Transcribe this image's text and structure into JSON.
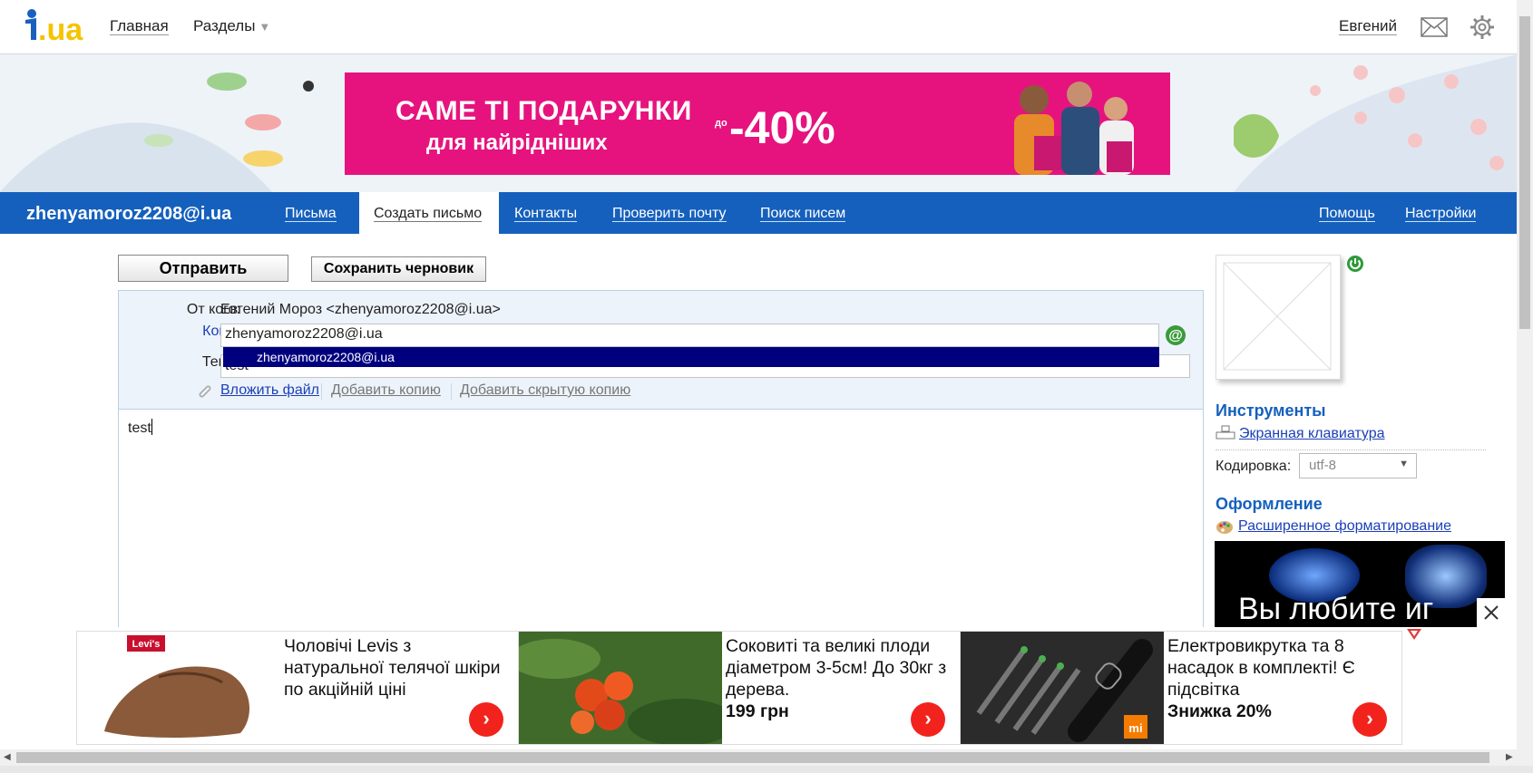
{
  "header": {
    "logo_text": "i.ua",
    "nav_home": "Главная",
    "nav_sections": "Разделы",
    "user_name": "Евгений"
  },
  "banner_ad": {
    "line1": "САМЕ ТІ ПОДАРУНКИ",
    "line2": "для найрідніших",
    "discount": "-40%",
    "prefix": "до"
  },
  "mail_nav": {
    "account": "zhenyamoroz2208@i.ua",
    "tabs": [
      "Письма",
      "Создать письмо",
      "Контакты",
      "Проверить почту",
      "Поиск писем"
    ],
    "active_tab": "Создать письмо",
    "help": "Помощь",
    "settings": "Настройки"
  },
  "toolbar": {
    "send_label": "Отправить",
    "draft_label": "Сохранить черновик"
  },
  "compose": {
    "from_label": "От кого:",
    "from_value": "Евгений Мороз <zhenyamoroz2208@i.ua>",
    "to_label": "Кому:",
    "to_value": "zhenyamoroz2208@i.ua",
    "autocomplete_item": "zhenyamoroz2208@i.ua",
    "subject_label": "Тема:",
    "subject_value": "test",
    "attach_label": "Вложить файл",
    "add_cc_label": "Добавить копию",
    "add_bcc_label": "Добавить скрытую копию",
    "body_text": "test"
  },
  "sidebar": {
    "tools_title": "Инструменты",
    "keyboard_link": "Экранная клавиатура",
    "encoding_label": "Кодировка:",
    "encoding_value": "utf-8",
    "design_title": "Оформление",
    "formatting_link": "Расширенное форматирование",
    "ad_text": "Вы любите иг"
  },
  "bottom_ads": [
    {
      "text": "Чоловічі Levis з натуральної телячої шкіри по акційній ціні",
      "price": "",
      "brand": "Levi's"
    },
    {
      "text": "Соковиті та великі плоди діаметром 3-5см! До 30кг з дерева.",
      "price": "199 грн",
      "brand": ""
    },
    {
      "text": "Електровикрутка та 8 насадок в комплекті! Є підсвітка",
      "price": "Знижка 20%",
      "brand": "mi"
    }
  ],
  "colors": {
    "nav_blue": "#1560bd",
    "ad_pink": "#e6137e",
    "go_red": "#f2231d",
    "autocomplete_bg": "#00007f"
  }
}
